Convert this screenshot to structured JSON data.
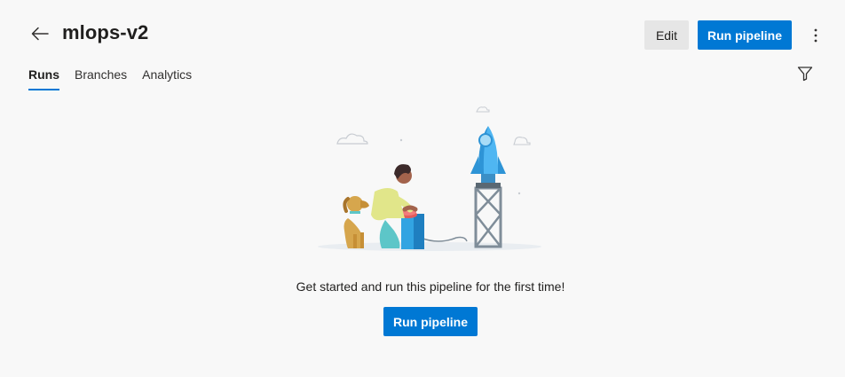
{
  "header": {
    "title": "mlops-v2",
    "edit_label": "Edit",
    "run_label": "Run pipeline"
  },
  "tabs": [
    {
      "label": "Runs",
      "active": true
    },
    {
      "label": "Branches",
      "active": false
    },
    {
      "label": "Analytics",
      "active": false
    }
  ],
  "empty_state": {
    "message": "Get started and run this pipeline for the first time!",
    "button_label": "Run pipeline"
  },
  "icons": {
    "back": "arrow-left-icon",
    "more": "more-vertical-icon",
    "filter": "filter-icon"
  },
  "colors": {
    "accent": "#0078d4",
    "background": "#f8f8f8",
    "secondary_button": "#e6e6e6"
  }
}
